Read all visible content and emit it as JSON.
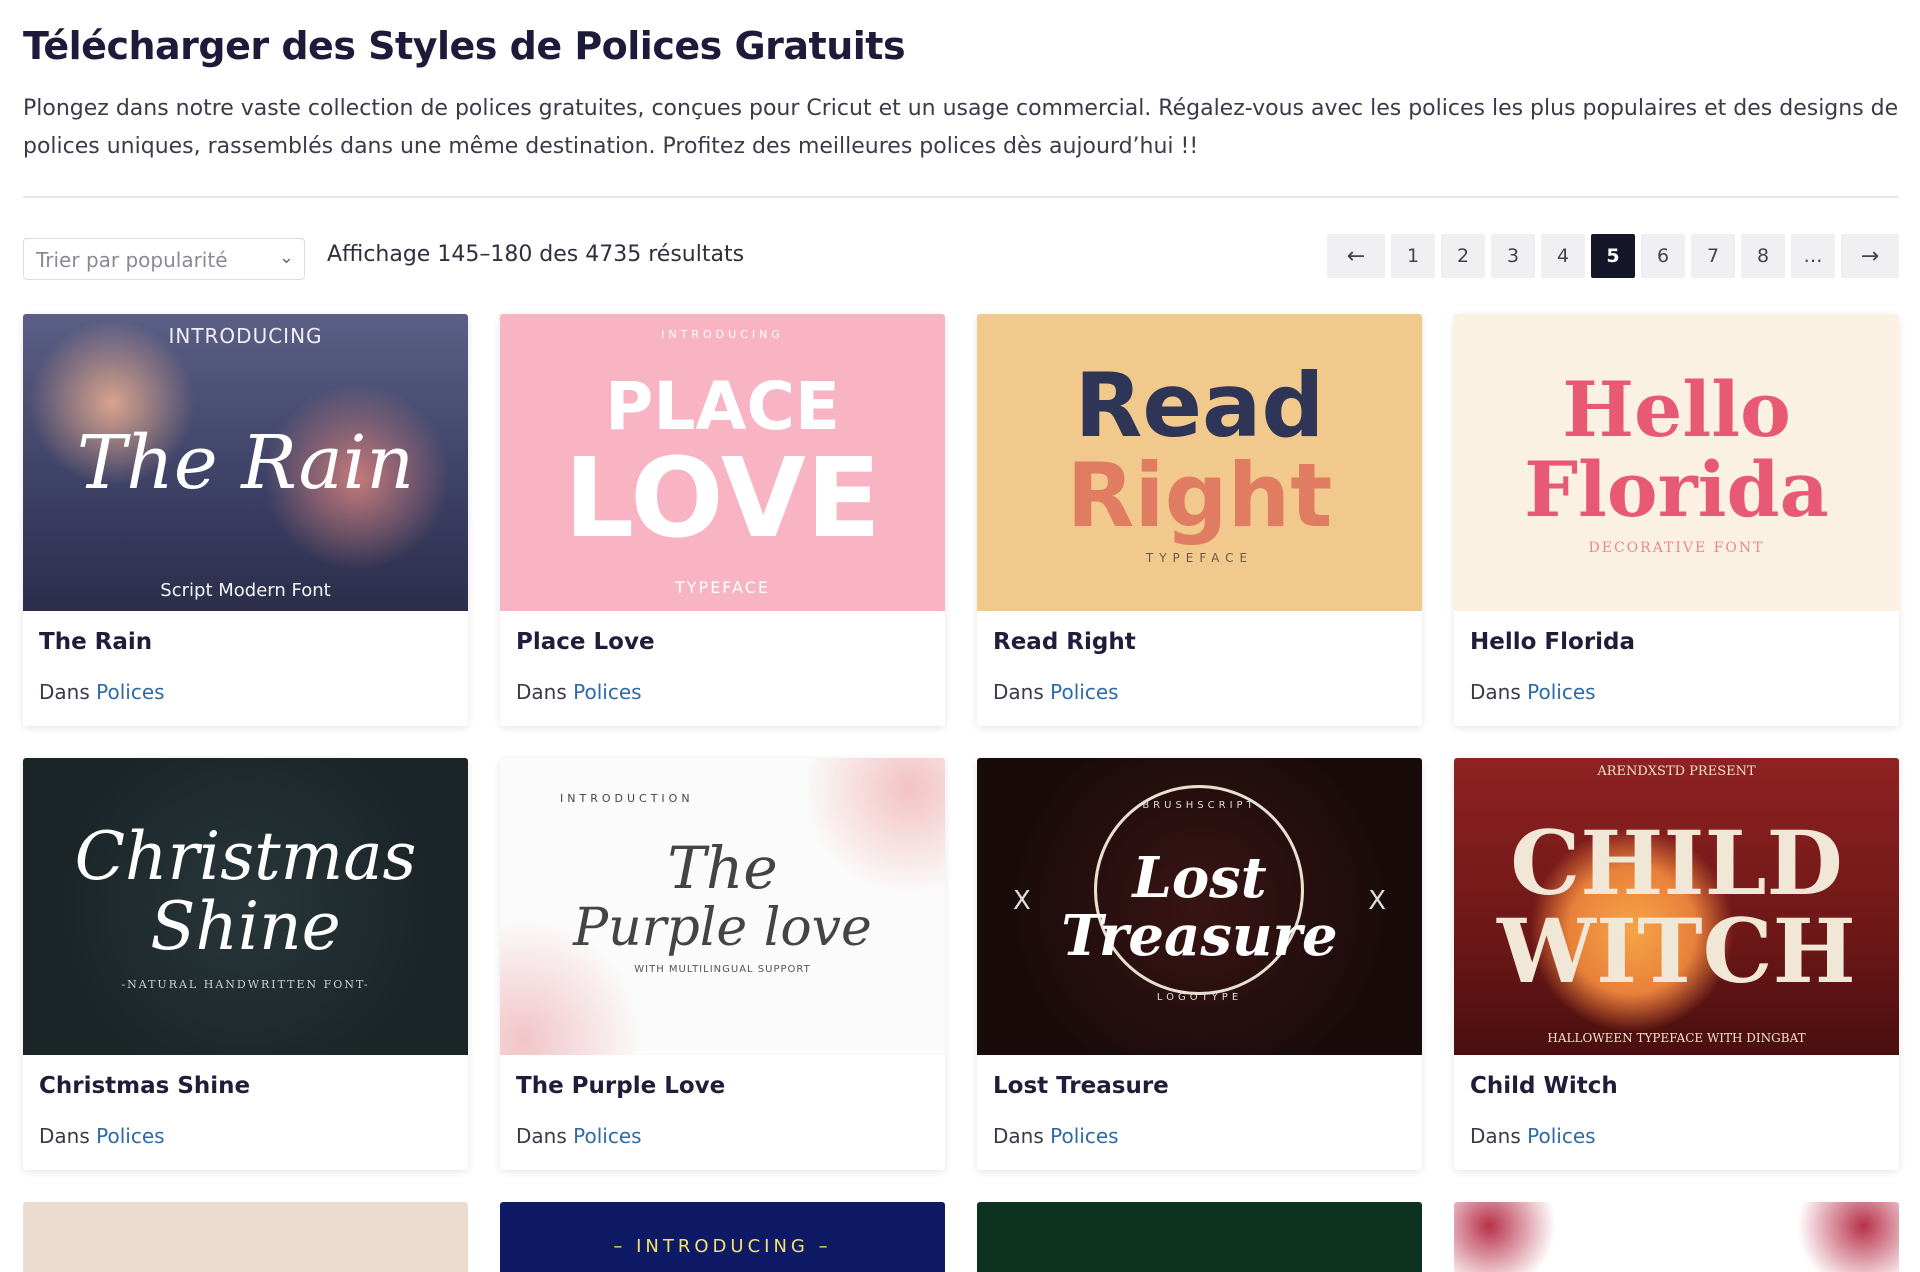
{
  "header": {
    "title": "Télécharger des Styles de Polices Gratuits",
    "description": "Plongez dans notre vaste collection de polices gratuites, conçues pour Cricut et un usage commercial. Régalez-vous avec les polices les plus populaires et des designs de polices uniques, rassemblés dans une même destination. Profitez des meilleures polices dès aujourd’hui !!"
  },
  "toolbar": {
    "sort_value": "Trier par popularité",
    "results_text": "Affichage 145–180 des 4735 résultats"
  },
  "pagination": {
    "prev": "←",
    "pages": [
      "1",
      "2",
      "3",
      "4",
      "5",
      "6",
      "7",
      "8",
      "…"
    ],
    "active": "5",
    "next": "→"
  },
  "cards": [
    {
      "name": "The Rain",
      "in": "Dans",
      "category": "Polices",
      "art_main": "The Rain",
      "art_top": "INTRODUCING",
      "art_bottom": "Script Modern Font"
    },
    {
      "name": "Place Love",
      "in": "Dans",
      "category": "Polices",
      "art_main": "PLACE",
      "art_main2": "LOVE",
      "art_top": "INTRODUCING",
      "art_bottom": "TYPEFACE"
    },
    {
      "name": "Read Right",
      "in": "Dans",
      "category": "Polices",
      "art_main": "Read",
      "art_main2": "Right",
      "art_bottom": "TYPEFACE"
    },
    {
      "name": "Hello Florida",
      "in": "Dans",
      "category": "Polices",
      "art_main": "Hello",
      "art_main2": "Florida",
      "art_bottom": "DECORATIVE FONT"
    },
    {
      "name": "Christmas Shine",
      "in": "Dans",
      "category": "Polices",
      "art_main": "Christmas",
      "art_main2": "Shine",
      "art_bottom": "-NATURAL HANDWRITTEN FONT-"
    },
    {
      "name": "The Purple Love",
      "in": "Dans",
      "category": "Polices",
      "art_main": "The",
      "art_main2": "Purple love",
      "art_top": "INTRODUCTION",
      "art_bottom": "WITH MULTILINGUAL SUPPORT"
    },
    {
      "name": "Lost Treasure",
      "in": "Dans",
      "category": "Polices",
      "art_main": "Lost",
      "art_main2": "Treasure",
      "art_top": "BRUSHSCRIPT",
      "art_bottom": "LOGOTYPE"
    },
    {
      "name": "Child Witch",
      "in": "Dans",
      "category": "Polices",
      "art_main": "CHILD",
      "art_main2": "WITCH",
      "art_top": "ARENDXSTD PRESENT",
      "art_bottom": "HALLOWEEN TYPEFACE WITH DINGBAT"
    }
  ],
  "partial_cards": [
    {
      "art_top": ""
    },
    {
      "art_top": "– INTRODUCING –"
    },
    {
      "art_top": ""
    },
    {
      "art_top": ""
    }
  ],
  "colors": {
    "accent_link": "#2e6aa8",
    "pager_active": "#15152a",
    "title": "#1e1b3a"
  }
}
